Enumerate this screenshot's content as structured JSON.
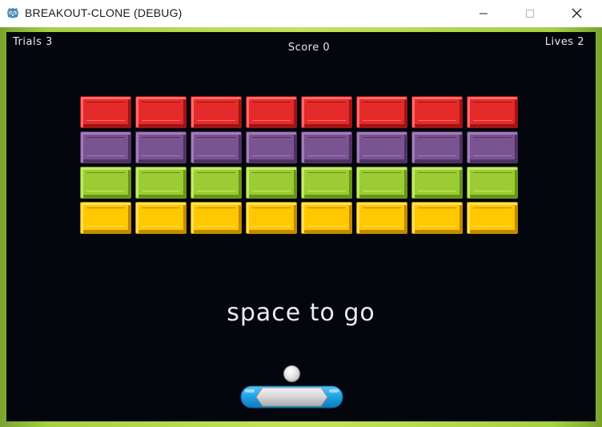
{
  "window": {
    "title": "BREAKOUT-CLONE (DEBUG)"
  },
  "hud": {
    "trials": "Trials 3",
    "score": "Score 0",
    "lives": "Lives 2"
  },
  "message": "space to go",
  "bricks": {
    "rows": [
      {
        "color": "red",
        "fill": "#e52a2a",
        "light": "#ff6a6a",
        "dark": "#9e1414"
      },
      {
        "color": "purple",
        "fill": "#7a5492",
        "light": "#a07cb8",
        "dark": "#4e3262"
      },
      {
        "color": "green",
        "fill": "#9ccc34",
        "light": "#c3e86a",
        "dark": "#6a9418"
      },
      {
        "color": "yellow",
        "fill": "#ffc800",
        "light": "#ffe15a",
        "dark": "#c28a00"
      }
    ],
    "columns": 8
  },
  "colors": {
    "playfield": "#03060d",
    "frame": "#a6cf45",
    "paddle_blue": "#1ea1e6",
    "paddle_grey": "#d6d6d6"
  },
  "icons": {
    "app": "godot-icon",
    "minimize": "minimize-icon",
    "maximize": "maximize-icon",
    "close": "close-icon"
  }
}
